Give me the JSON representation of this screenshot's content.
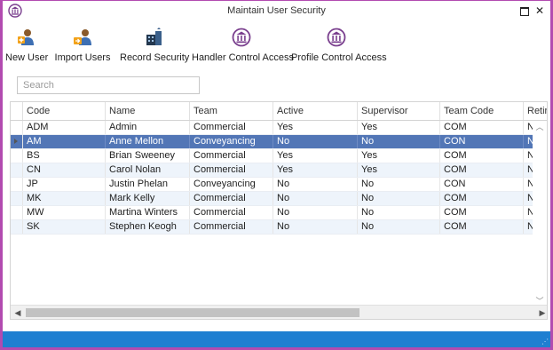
{
  "window": {
    "title": "Maintain User Security"
  },
  "colors": {
    "window_border": "#b24bb0",
    "selected_row": "#5276b6",
    "alt_row": "#eef4fb",
    "status_bar": "#1f7fd1"
  },
  "ribbon": [
    {
      "label": "New User",
      "icon": "user-add-icon"
    },
    {
      "label": "Import Users",
      "icon": "import-users-icon"
    },
    {
      "label": "Record Security",
      "icon": "building-security-icon"
    },
    {
      "label": "Handler Control Access",
      "icon": "institution-icon"
    },
    {
      "label": "Profile Control Access",
      "icon": "institution-icon"
    }
  ],
  "search": {
    "placeholder": "Search",
    "value": ""
  },
  "grid": {
    "columns": [
      "Code",
      "Name",
      "Team",
      "Active",
      "Supervisor",
      "Team Code",
      "Retir"
    ],
    "rows": [
      [
        "ADM",
        "Admin",
        "Commercial",
        "Yes",
        "Yes",
        "COM",
        "N"
      ],
      [
        "AM",
        "Anne Mellon",
        "Conveyancing",
        "No",
        "No",
        "CON",
        "N"
      ],
      [
        "BS",
        "Brian Sweeney",
        "Commercial",
        "Yes",
        "Yes",
        "COM",
        "N"
      ],
      [
        "CN",
        "Carol Nolan",
        "Commercial",
        "Yes",
        "Yes",
        "COM",
        "N"
      ],
      [
        "JP",
        "Justin Phelan",
        "Conveyancing",
        "No",
        "No",
        "CON",
        "N"
      ],
      [
        "MK",
        "Mark Kelly",
        "Commercial",
        "No",
        "No",
        "COM",
        "N"
      ],
      [
        "MW",
        "Martina Winters",
        "Commercial",
        "No",
        "No",
        "COM",
        "N"
      ],
      [
        "SK",
        "Stephen Keogh",
        "Commercial",
        "No",
        "No",
        "COM",
        "N"
      ]
    ],
    "selected_row_code": "AM"
  }
}
